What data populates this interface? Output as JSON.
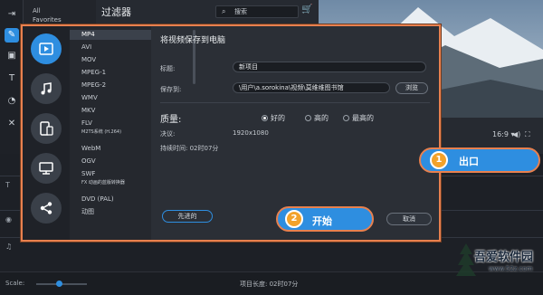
{
  "app": {
    "filters_column": [
      "All",
      "Favorites"
    ],
    "filter_title": "过滤器",
    "search_placeholder": "搜索",
    "preview_controls": {
      "aspect": "16:9 ▾"
    },
    "status_bar": {
      "scale_label": "Scale:",
      "project_length": "项目长度: 02时07分"
    }
  },
  "export_dialog": {
    "title": "将视频保存到电脑",
    "formats": [
      "MP4",
      "AVI",
      "MOV",
      "MPEG-1",
      "MPEG-2",
      "WMV",
      "MKV",
      "FLV",
      "M2TS系统 (H.264)",
      "WebM",
      "OGV",
      "SWF",
      "FX 动画的蓝版转换器",
      "DVD (PAL)",
      "动图"
    ],
    "selected_format": "MP4",
    "name_label": "标题:",
    "name_value": "新项目",
    "save_to_label": "保存到:",
    "save_to_value": "\\用户\\a.sorokina\\视频\\莫维维图书馆",
    "browse_label": "浏览",
    "quality_label": "质量:",
    "quality_options": [
      "好的",
      "高的",
      "最高的"
    ],
    "quality_selected": "好的",
    "resolution_label": "决议:",
    "resolution_value": "1920x1080",
    "duration_label": "持续时间: 02时07分",
    "advanced_label": "先进的",
    "start_label": "开始",
    "cancel_label": "取消"
  },
  "callouts": {
    "step1_number": "1",
    "step1_label": "出口",
    "step2_number": "2"
  },
  "watermark": {
    "name": "吾爱软件园",
    "url": "www.52z.com"
  },
  "colors": {
    "accent_blue": "#2e8ee0",
    "highlight_orange": "#e8804e",
    "badge_yellow": "#f2a22b",
    "dialog_bg": "#2b2f36"
  },
  "icons": {
    "rail": [
      "video-player-icon",
      "music-note-icon",
      "devices-icon",
      "monitor-icon",
      "share-icon"
    ]
  }
}
